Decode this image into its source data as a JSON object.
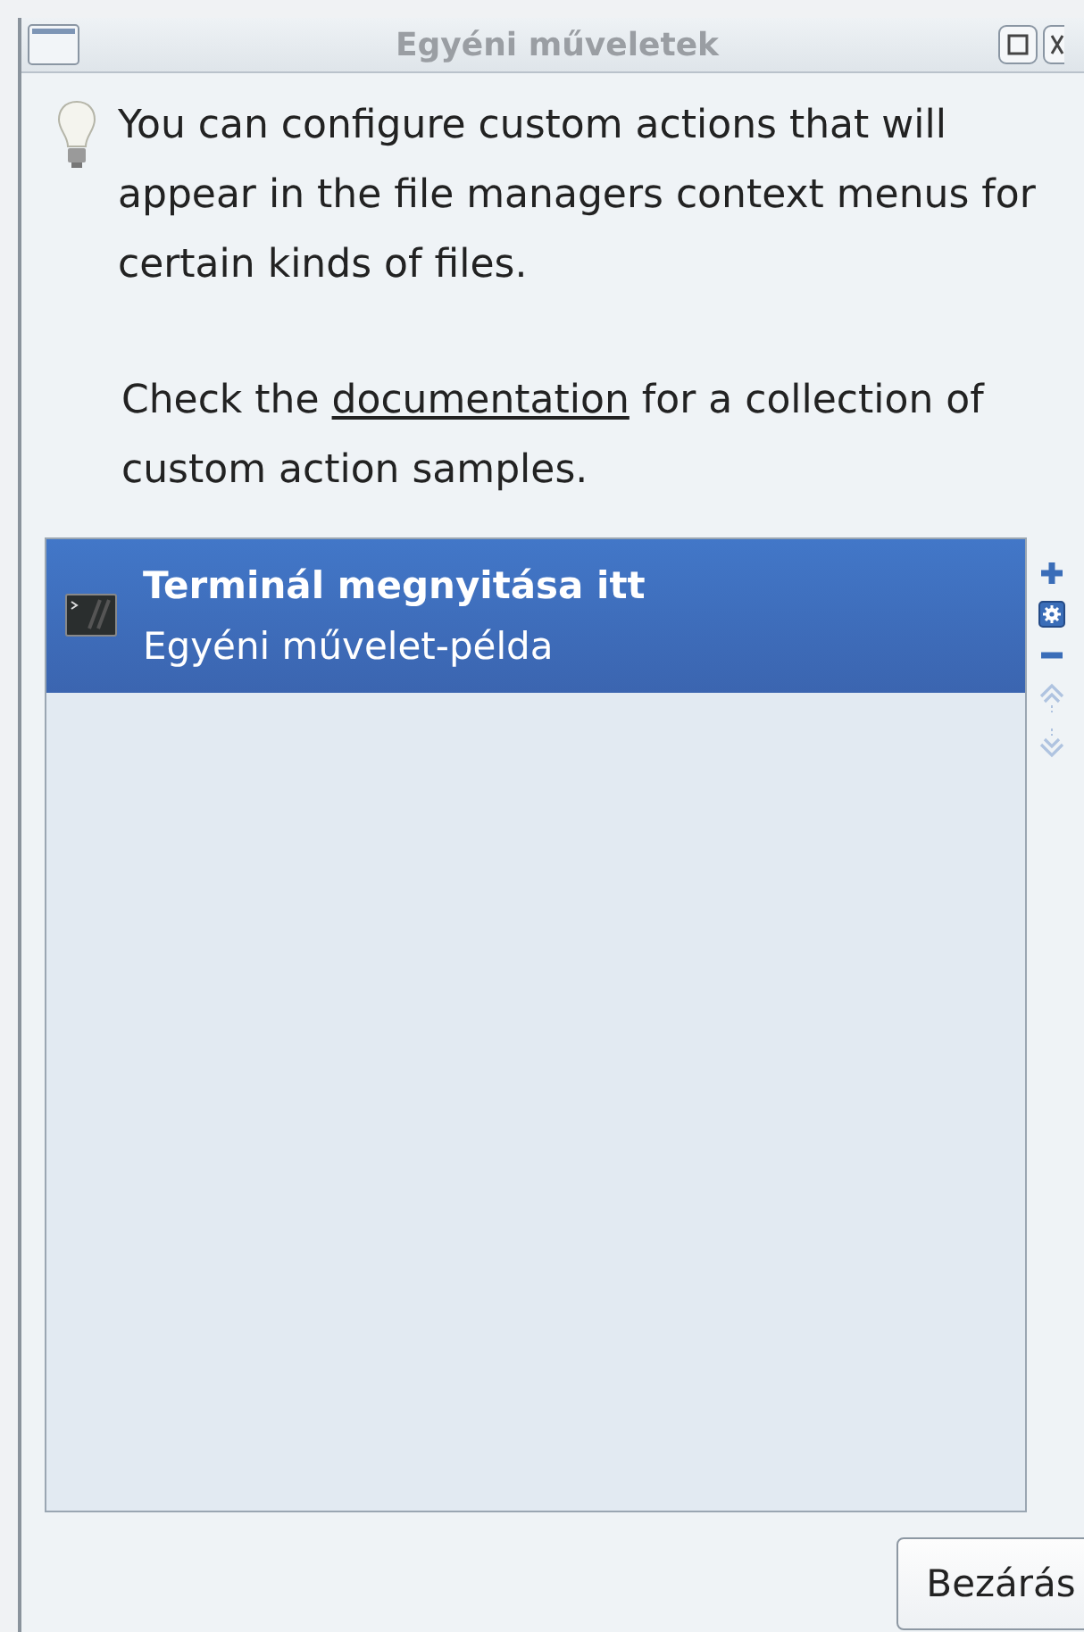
{
  "window": {
    "title": "Egyéni műveletek"
  },
  "intro": {
    "text": "You can configure custom actions that will appear in the file managers context menus for certain kinds of files.",
    "doc_before": "Check the ",
    "doc_link": "documentation",
    "doc_after": " for a collection of custom action samples."
  },
  "actions": [
    {
      "name": "Terminál megnyitása itt",
      "description": "Egyéni művelet-példa",
      "selected": true
    }
  ],
  "toolbar": [
    {
      "kind": "add",
      "disabled": false
    },
    {
      "kind": "edit",
      "disabled": false
    },
    {
      "kind": "remove",
      "disabled": false
    },
    {
      "kind": "up",
      "disabled": true
    },
    {
      "kind": "down",
      "disabled": true
    }
  ],
  "buttons": [
    "Bezárás"
  ]
}
